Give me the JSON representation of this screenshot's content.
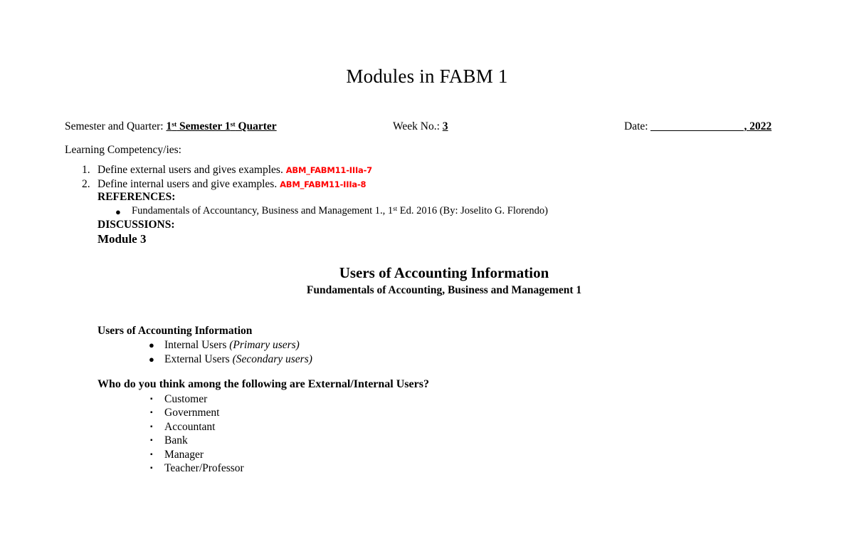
{
  "document": {
    "title": "Modules in FABM 1"
  },
  "header": {
    "semester_label": "Semester and Quarter: ",
    "semester_value_pre": "1",
    "semester_value_sup1": "st",
    "semester_value_mid": "  Semester 1",
    "semester_value_sup2": "st",
    "semester_value_post": " Quarter",
    "week_label": "Week No.: ",
    "week_value": "3",
    "date_label": "Date: ",
    "date_year": ", 2022"
  },
  "competency": {
    "label": "Learning Competency/ies:",
    "items": [
      {
        "number": "1.",
        "text": "Define external users and gives examples. ",
        "code": "ABM_FABM11-IIIa-7"
      },
      {
        "number": "2.",
        "text": "Define internal users and give examples. ",
        "code": "ABM_FABM11-IIIa-8"
      }
    ],
    "code_color": "#FF0000"
  },
  "references": {
    "heading": "REFERENCES:",
    "bullet": "●",
    "item_pre": "Fundamentals of Accountancy, Business and Management 1., 1",
    "item_sup": "st",
    "item_post": " Ed. 2016 (By: Joselito G. Florendo)"
  },
  "discussions": {
    "heading": "DISCUSSIONS:",
    "module": "Module 3"
  },
  "section": {
    "title": "Users of Accounting Information",
    "subtitle": "Fundamentals of Accounting, Business and Management 1"
  },
  "body": {
    "users_heading": "Users of Accounting Information",
    "bullet": "●",
    "users": [
      {
        "label": "Internal Users ",
        "paren": "(Primary users)"
      },
      {
        "label": "External Users ",
        "paren": "(Secondary users)"
      }
    ],
    "question": "Who do you think among the following are External/Internal Users?",
    "square_bullet": "▪",
    "choices": [
      "Customer",
      "Government",
      "Accountant",
      "Bank",
      "Manager",
      "Teacher/Professor"
    ]
  }
}
